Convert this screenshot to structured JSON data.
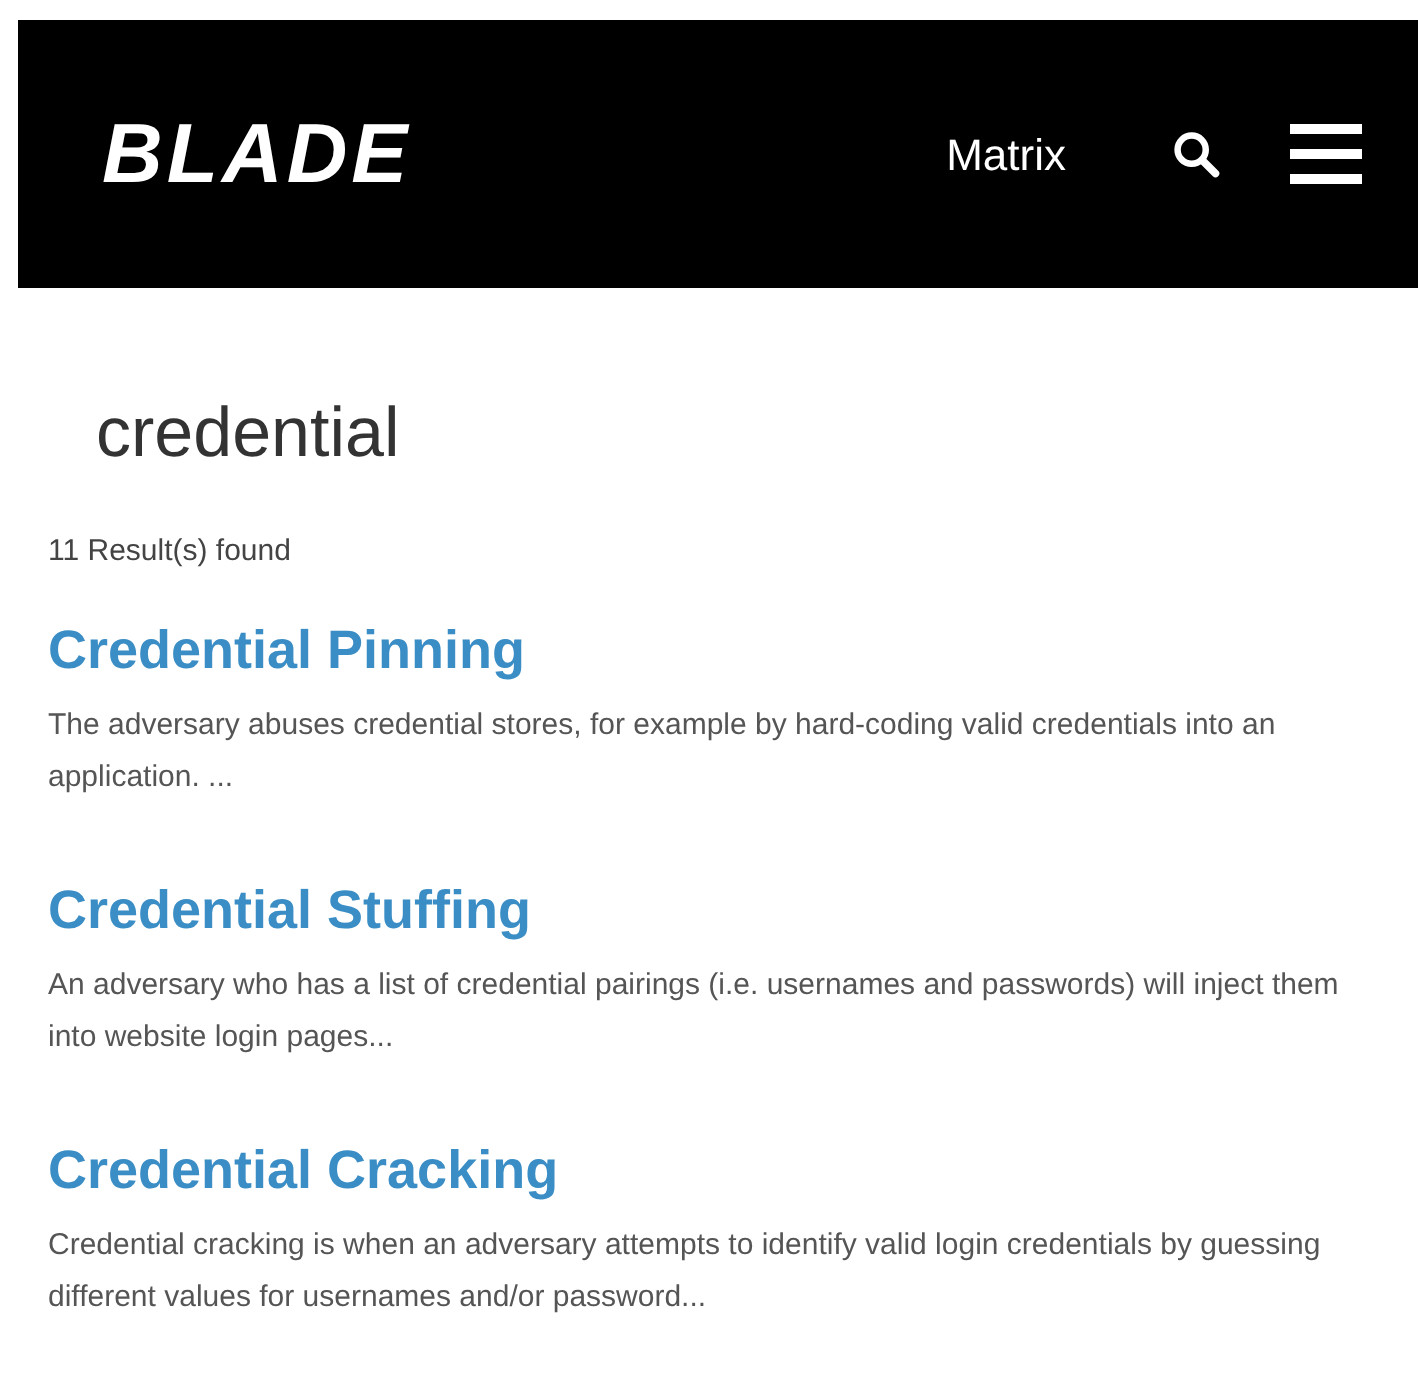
{
  "header": {
    "logo": "BLADE",
    "nav_link": "Matrix"
  },
  "search": {
    "query": "credential"
  },
  "result_count": "11 Result(s) found",
  "results": [
    {
      "title": "Credential Pinning",
      "description": "The adversary abuses credential stores, for example by hard-coding valid credentials into an application. ..."
    },
    {
      "title": "Credential Stuffing",
      "description": "An adversary who has a list of credential pairings (i.e. usernames and passwords) will inject them into website login pages..."
    },
    {
      "title": "Credential Cracking",
      "description": "Credential cracking is when an adversary attempts to identify valid login credentials by guessing different values for usernames and/or password..."
    }
  ]
}
